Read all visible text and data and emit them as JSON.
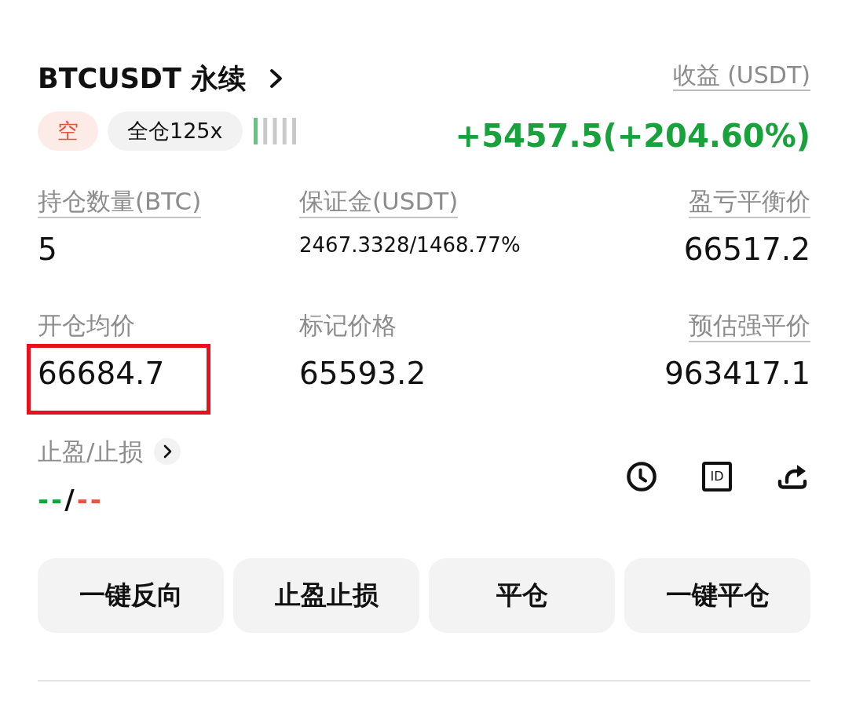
{
  "header": {
    "title": "BTCUSDT 永续",
    "side_tag": {
      "text": "空",
      "short": true
    },
    "margin_tag": "全仓125x",
    "risk_meter": {
      "level": 0.2
    }
  },
  "pnl": {
    "label": "收益 (USDT)",
    "underlined": true,
    "value": "+5457.5(+204.60%)",
    "positive": true
  },
  "stats": [
    {
      "label": "持仓数量(BTC)",
      "underlined": true,
      "value": "5",
      "highlighted": false
    },
    {
      "label": "保证金(USDT)",
      "underlined": true,
      "value": "2467.3328/1468.77%",
      "highlighted": false
    },
    {
      "label": "盈亏平衡价",
      "underlined": true,
      "value": "66517.2",
      "highlighted": false
    },
    {
      "label": "开仓均价",
      "underlined": false,
      "value": "66684.7",
      "highlighted": true
    },
    {
      "label": "标记价格",
      "underlined": false,
      "value": "65593.2",
      "highlighted": false
    },
    {
      "label": "预估强平价",
      "underlined": true,
      "value": "963417.1",
      "highlighted": false
    }
  ],
  "tpsl": {
    "label": "止盈/止损",
    "take_profit": "--",
    "separator": "/",
    "stop_loss": "--"
  },
  "tools": [
    {
      "kind": "history"
    },
    {
      "kind": "id",
      "text": "ID"
    },
    {
      "kind": "share"
    }
  ],
  "buttons": [
    "一键反向",
    "止盈止损",
    "平仓",
    "一键平仓"
  ]
}
